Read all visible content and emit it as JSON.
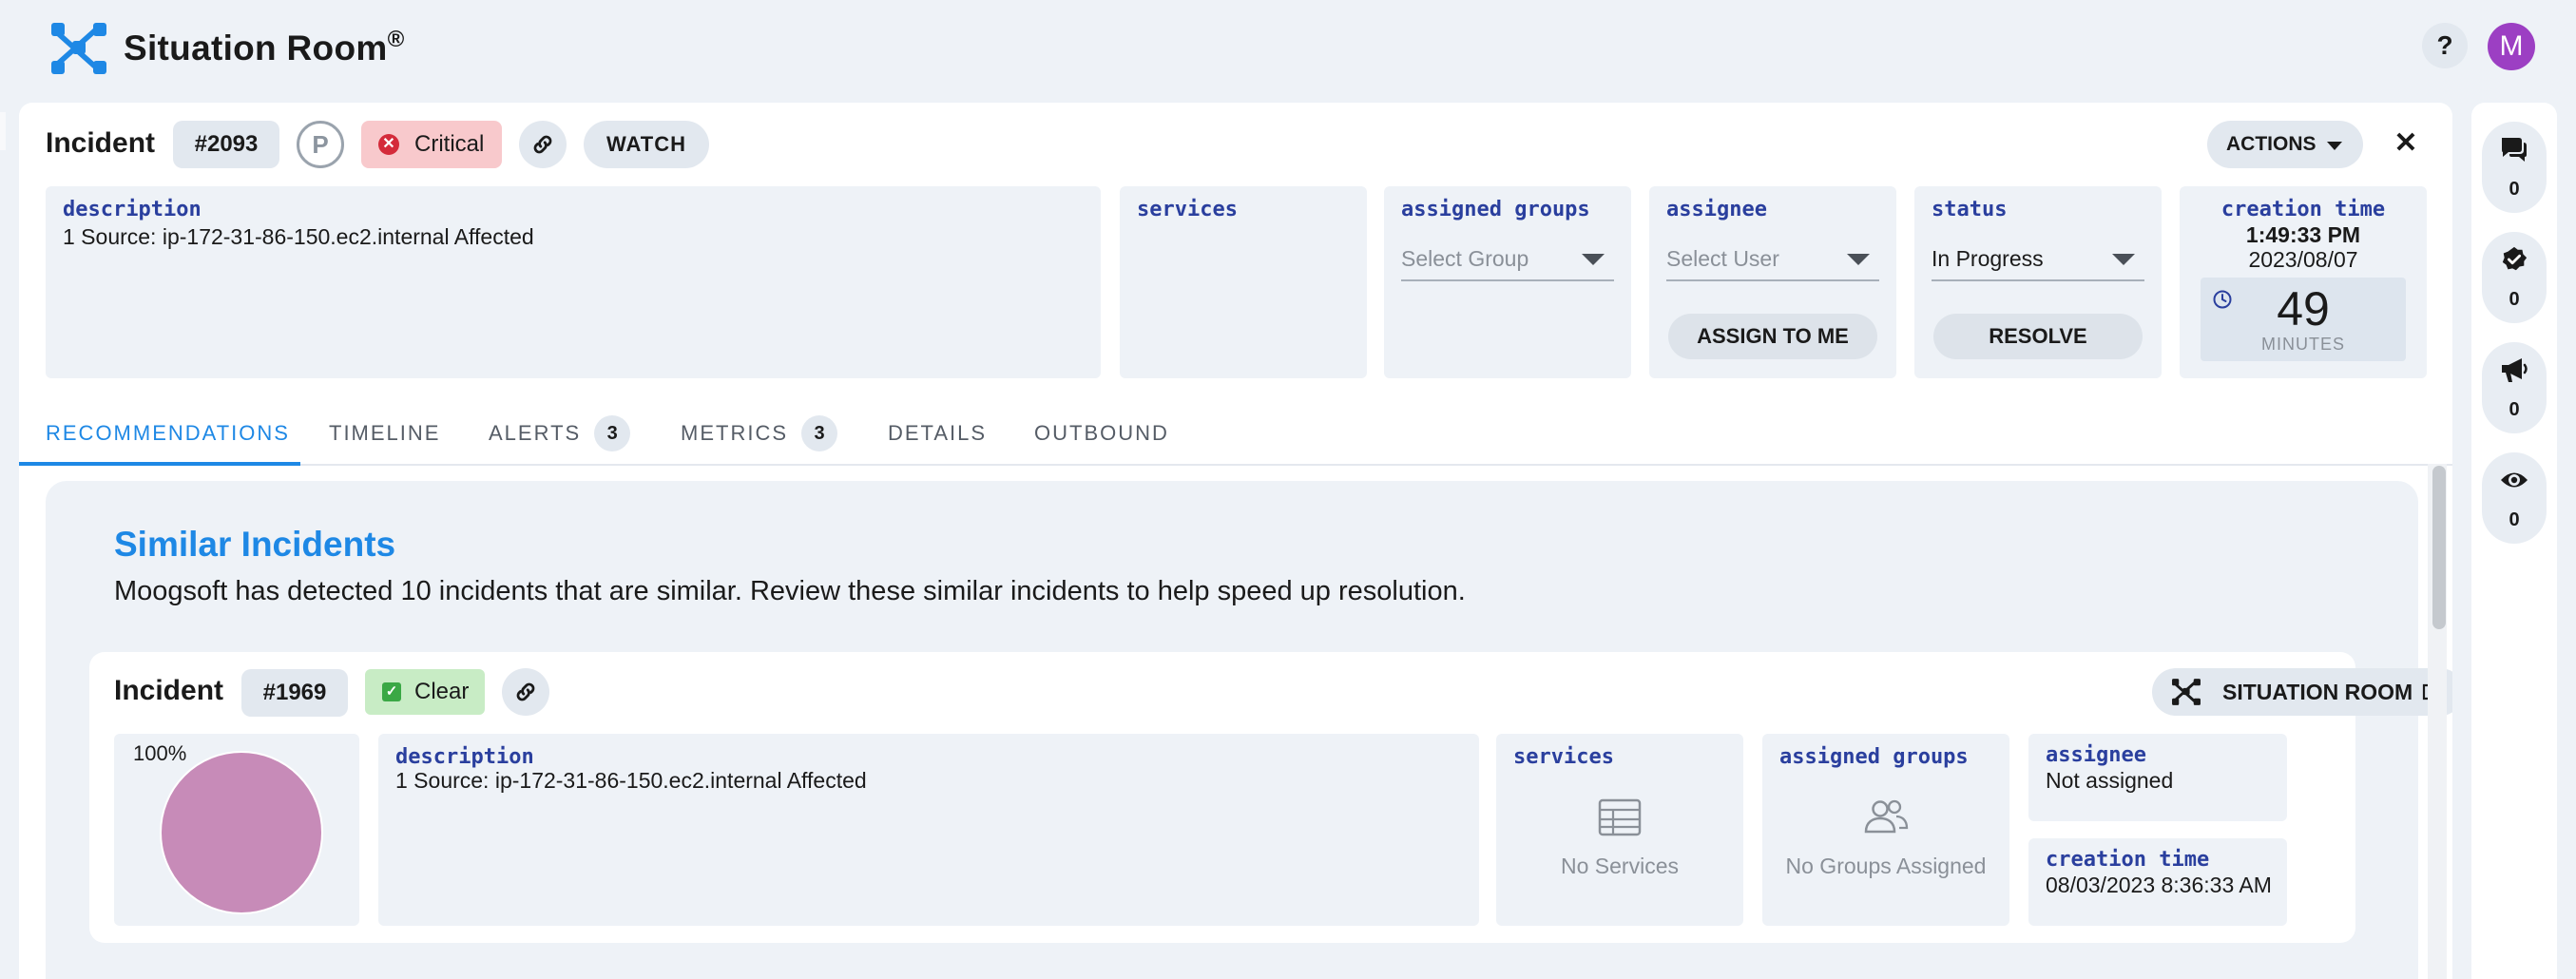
{
  "app": {
    "title": "Situation Room",
    "title_mark": "®",
    "help_label": "?",
    "avatar_initial": "M"
  },
  "incident": {
    "label": "Incident",
    "id": "#2093",
    "priority": "P",
    "severity": "Critical",
    "watch_label": "WATCH",
    "actions_label": "ACTIONS",
    "close_label": "✕"
  },
  "fields": {
    "description": {
      "label": "description",
      "value": "1 Source: ip-172-31-86-150.ec2.internal Affected"
    },
    "services": {
      "label": "services"
    },
    "assigned_groups": {
      "label": "assigned groups",
      "placeholder": "Select Group"
    },
    "assignee": {
      "label": "assignee",
      "placeholder": "Select User",
      "button": "ASSIGN TO ME"
    },
    "status": {
      "label": "status",
      "value": "In Progress",
      "button": "RESOLVE"
    },
    "creation_time": {
      "label": "creation time",
      "time": "1:49:33 PM",
      "date": "2023/08/07",
      "elapsed": "49",
      "elapsed_unit": "MINUTES"
    }
  },
  "tabs": [
    {
      "label": "RECOMMENDATIONS",
      "active": true
    },
    {
      "label": "TIMELINE"
    },
    {
      "label": "ALERTS",
      "badge": "3"
    },
    {
      "label": "METRICS",
      "badge": "3"
    },
    {
      "label": "DETAILS"
    },
    {
      "label": "OUTBOUND"
    }
  ],
  "recommendations": {
    "title": "Similar Incidents",
    "text": "Moogsoft has detected 10 incidents that are similar. Review these similar incidents to help speed up resolution.",
    "similar": {
      "label": "Incident",
      "id": "#1969",
      "status": "Clear",
      "situation_room_label": "SITUATION ROOM",
      "similarity": "100%",
      "similarity_value": 1.0,
      "description_label": "description",
      "description": "1 Source: ip-172-31-86-150.ec2.internal Affected",
      "services_label": "services",
      "services_empty": "No Services",
      "groups_label": "assigned groups",
      "groups_empty": "No Groups Assigned",
      "assignee_label": "assignee",
      "assignee": "Not assigned",
      "creation_label": "creation time",
      "creation_time": "08/03/2023 8:36:33 AM"
    }
  },
  "sidebar": {
    "comments_count": "0",
    "resolutions_count": "0",
    "announcements_count": "0",
    "watchers_count": "0"
  },
  "colors": {
    "accent": "#1e88e5",
    "critical": "#d42b3a",
    "clear": "#3aa845",
    "avatar": "#9c3fc3",
    "pie": "#c78bb8"
  },
  "icons": [
    "app-logo-icon",
    "link-icon",
    "chevron-down-icon",
    "clock-icon",
    "table-icon",
    "people-icon",
    "external-link-icon",
    "chat-icon",
    "check-badge-icon",
    "megaphone-icon",
    "eye-icon"
  ]
}
